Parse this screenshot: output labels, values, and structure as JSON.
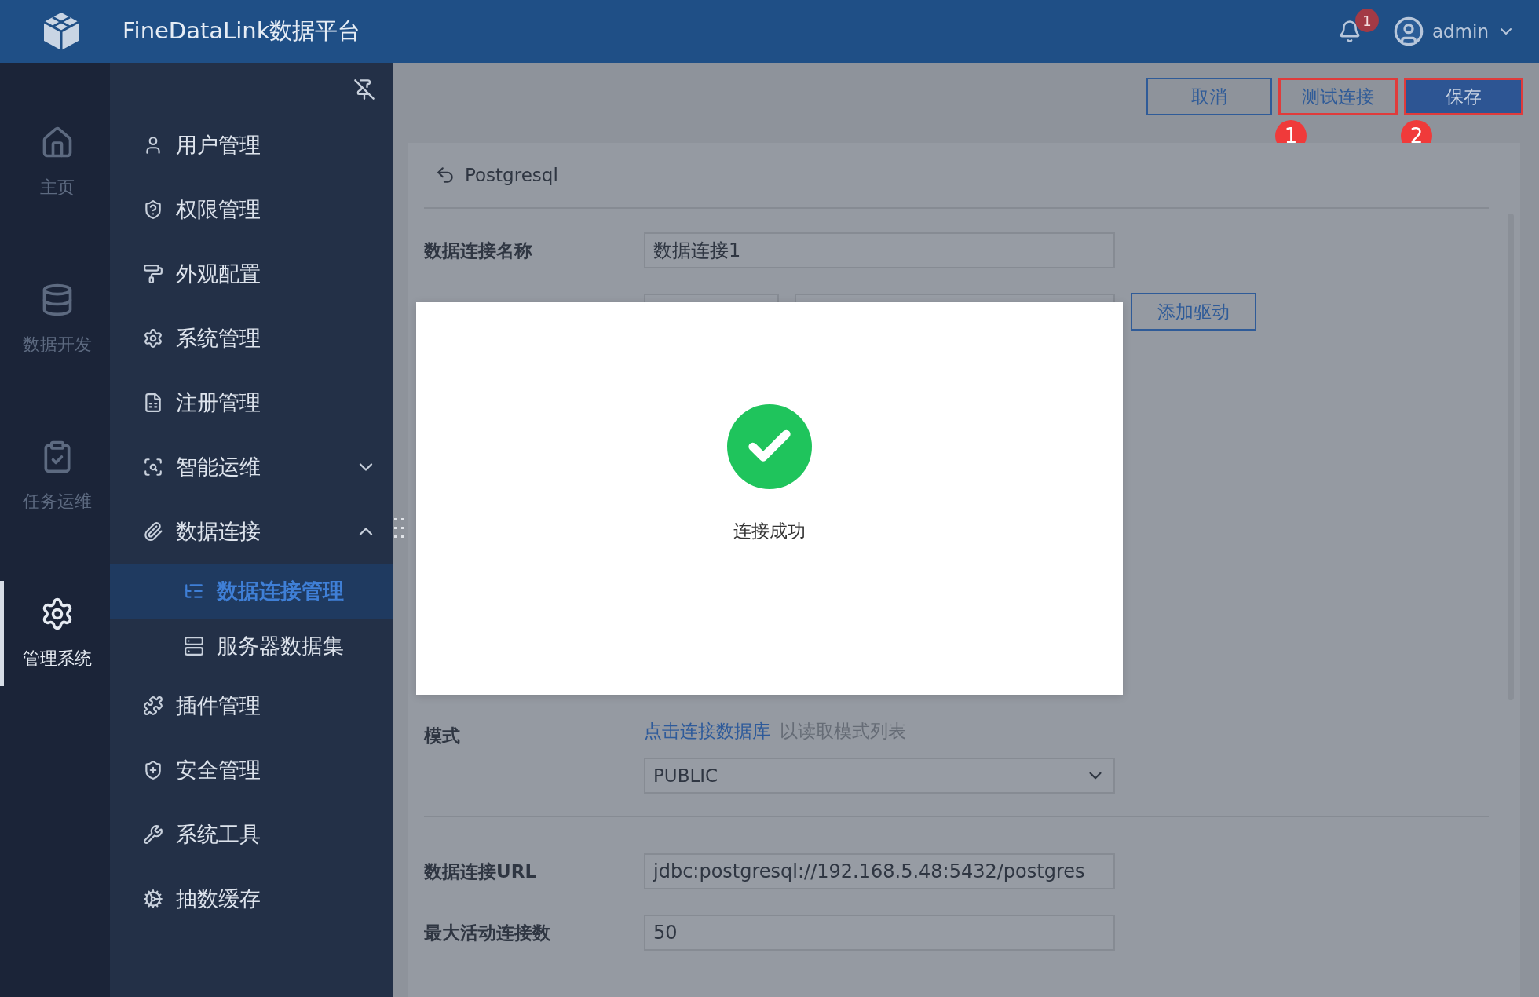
{
  "topbar": {
    "app_title": "FineDataLink数据平台",
    "notification_count": "1",
    "user": "admin"
  },
  "rail": {
    "items": [
      {
        "label": "主页",
        "selected": false
      },
      {
        "label": "数据开发",
        "selected": false
      },
      {
        "label": "任务运维",
        "selected": false
      },
      {
        "label": "管理系统",
        "selected": true
      }
    ]
  },
  "sidebar": {
    "items": [
      {
        "label": "用户管理",
        "kind": "link",
        "selected": false
      },
      {
        "label": "权限管理",
        "kind": "link",
        "selected": false
      },
      {
        "label": "外观配置",
        "kind": "link",
        "selected": false
      },
      {
        "label": "系统管理",
        "kind": "link",
        "selected": false
      },
      {
        "label": "注册管理",
        "kind": "link",
        "selected": false
      },
      {
        "label": "智能运维",
        "kind": "group",
        "expanded": false,
        "selected": false
      },
      {
        "label": "数据连接",
        "kind": "group",
        "expanded": true,
        "selected": false,
        "children": [
          {
            "label": "数据连接管理",
            "selected": true
          },
          {
            "label": "服务器数据集",
            "selected": false
          }
        ]
      },
      {
        "label": "插件管理",
        "kind": "link",
        "selected": false
      },
      {
        "label": "安全管理",
        "kind": "link",
        "selected": false
      },
      {
        "label": "系统工具",
        "kind": "link",
        "selected": false
      },
      {
        "label": "抽数缓存",
        "kind": "link",
        "selected": false
      }
    ]
  },
  "toolbar": {
    "buttons": [
      {
        "label": "取消",
        "kind": "outline",
        "highlighted": false
      },
      {
        "label": "测试连接",
        "kind": "outline",
        "highlighted": true,
        "step_badge": "1"
      },
      {
        "label": "保存",
        "kind": "primary",
        "highlighted": true,
        "step_badge": "2"
      }
    ]
  },
  "form": {
    "back_label": "Postgresql",
    "rows": [
      {
        "kind": "text",
        "label": "数据连接名称",
        "value": "数据连接1"
      },
      {
        "kind": "driver",
        "button": "添加驱动"
      },
      {
        "kind": "mode",
        "label": "模式",
        "link": "点击连接数据库",
        "hint": "以读取模式列表",
        "value": "PUBLIC"
      },
      {
        "kind": "divider"
      },
      {
        "kind": "text",
        "label": "数据连接URL",
        "value": "jdbc:postgresql://192.168.5.48:5432/postgres"
      },
      {
        "kind": "text",
        "label": "最大活动连接数",
        "value": "50"
      }
    ]
  },
  "dialog": {
    "message": "连接成功"
  }
}
